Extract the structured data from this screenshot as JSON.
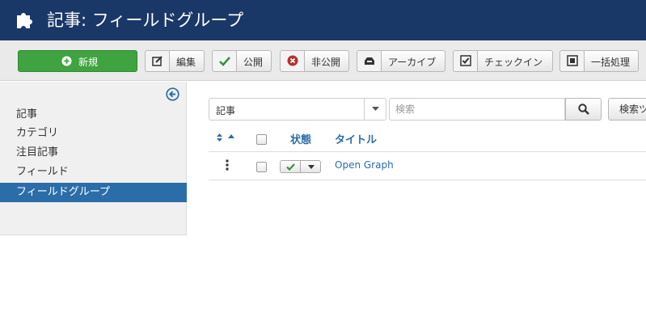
{
  "header": {
    "title": "記事: フィールドグループ",
    "icon": "puzzle-icon"
  },
  "toolbar": {
    "new_label": "新規",
    "edit_label": "編集",
    "publish_label": "公開",
    "unpublish_label": "非公開",
    "archive_label": "アーカイブ",
    "checkin_label": "チェックイン",
    "batch_label": "一括処理"
  },
  "sidebar": {
    "items": [
      {
        "label": "記事",
        "active": false
      },
      {
        "label": "カテゴリ",
        "active": false
      },
      {
        "label": "注目記事",
        "active": false
      },
      {
        "label": "フィールド",
        "active": false
      },
      {
        "label": "フィールドグループ",
        "active": true
      }
    ]
  },
  "filters": {
    "context_value": "記事",
    "search_placeholder": "検索",
    "search_tools_label": "検索ツール"
  },
  "table": {
    "columns": {
      "status": "状態",
      "title": "タイトル"
    },
    "rows": [
      {
        "title": "Open Graph",
        "published": true
      }
    ]
  },
  "colors": {
    "header_bg": "#1a3867",
    "accent": "#2b6da8",
    "new_button": "#3fa33f",
    "published_check": "#3a8f3a",
    "unpublish_icon": "#b53030"
  }
}
